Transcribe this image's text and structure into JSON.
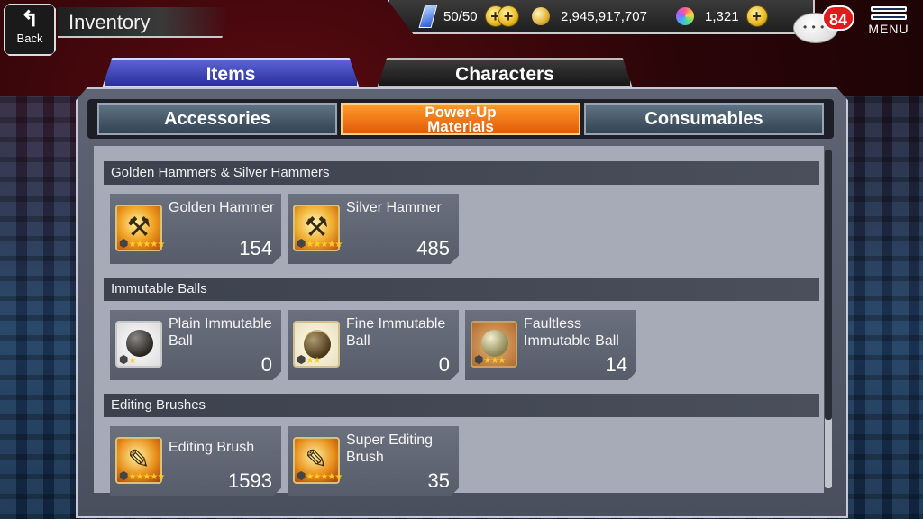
{
  "header": {
    "back_label": "Back",
    "back_icon": "back-arrow-icon",
    "title": "Inventory"
  },
  "status": {
    "stamina": "50/50",
    "coins": "2,945,917,707",
    "gems": "1,321",
    "plus_glyph": "+"
  },
  "chat": {
    "badge_count": "84"
  },
  "menu": {
    "label": "MENU"
  },
  "main_tabs": [
    {
      "label": "Items",
      "active": true
    },
    {
      "label": "Characters",
      "active": false
    }
  ],
  "sub_tabs": [
    {
      "label": "Accessories",
      "active": false
    },
    {
      "label_line1": "Power-Up",
      "label_line2": "Materials",
      "active": true
    },
    {
      "label": "Consumables",
      "active": false
    }
  ],
  "sections": [
    {
      "title": "Golden Hammers & Silver Hammers",
      "items": [
        {
          "name": "Golden Hammer",
          "count": "154",
          "stars": "★★★★★",
          "icon": "golden-hammer-icon"
        },
        {
          "name": "Silver Hammer",
          "count": "485",
          "stars": "★★★★★",
          "icon": "silver-hammer-icon"
        }
      ]
    },
    {
      "title": "Immutable Balls",
      "items": [
        {
          "name": "Plain Immutable Ball",
          "count": "0",
          "stars": "★",
          "icon": "plain-immutable-ball-icon"
        },
        {
          "name": "Fine Immutable Ball",
          "count": "0",
          "stars": "★★",
          "icon": "fine-immutable-ball-icon"
        },
        {
          "name": "Faultless Immutable Ball",
          "count": "14",
          "stars": "★★★",
          "icon": "faultless-immutable-ball-icon"
        }
      ]
    },
    {
      "title": "Editing Brushes",
      "items": [
        {
          "name": "Editing Brush",
          "count": "1593",
          "stars": "★★★★★",
          "icon": "editing-brush-icon"
        },
        {
          "name": "Super Editing Brush",
          "count": "35",
          "stars": "★★★★★",
          "icon": "super-editing-brush-icon"
        }
      ]
    }
  ],
  "colors": {
    "active_subtab": "#e25a08",
    "items_tab": "#2a2f9a",
    "badge": "#e31a1a"
  }
}
